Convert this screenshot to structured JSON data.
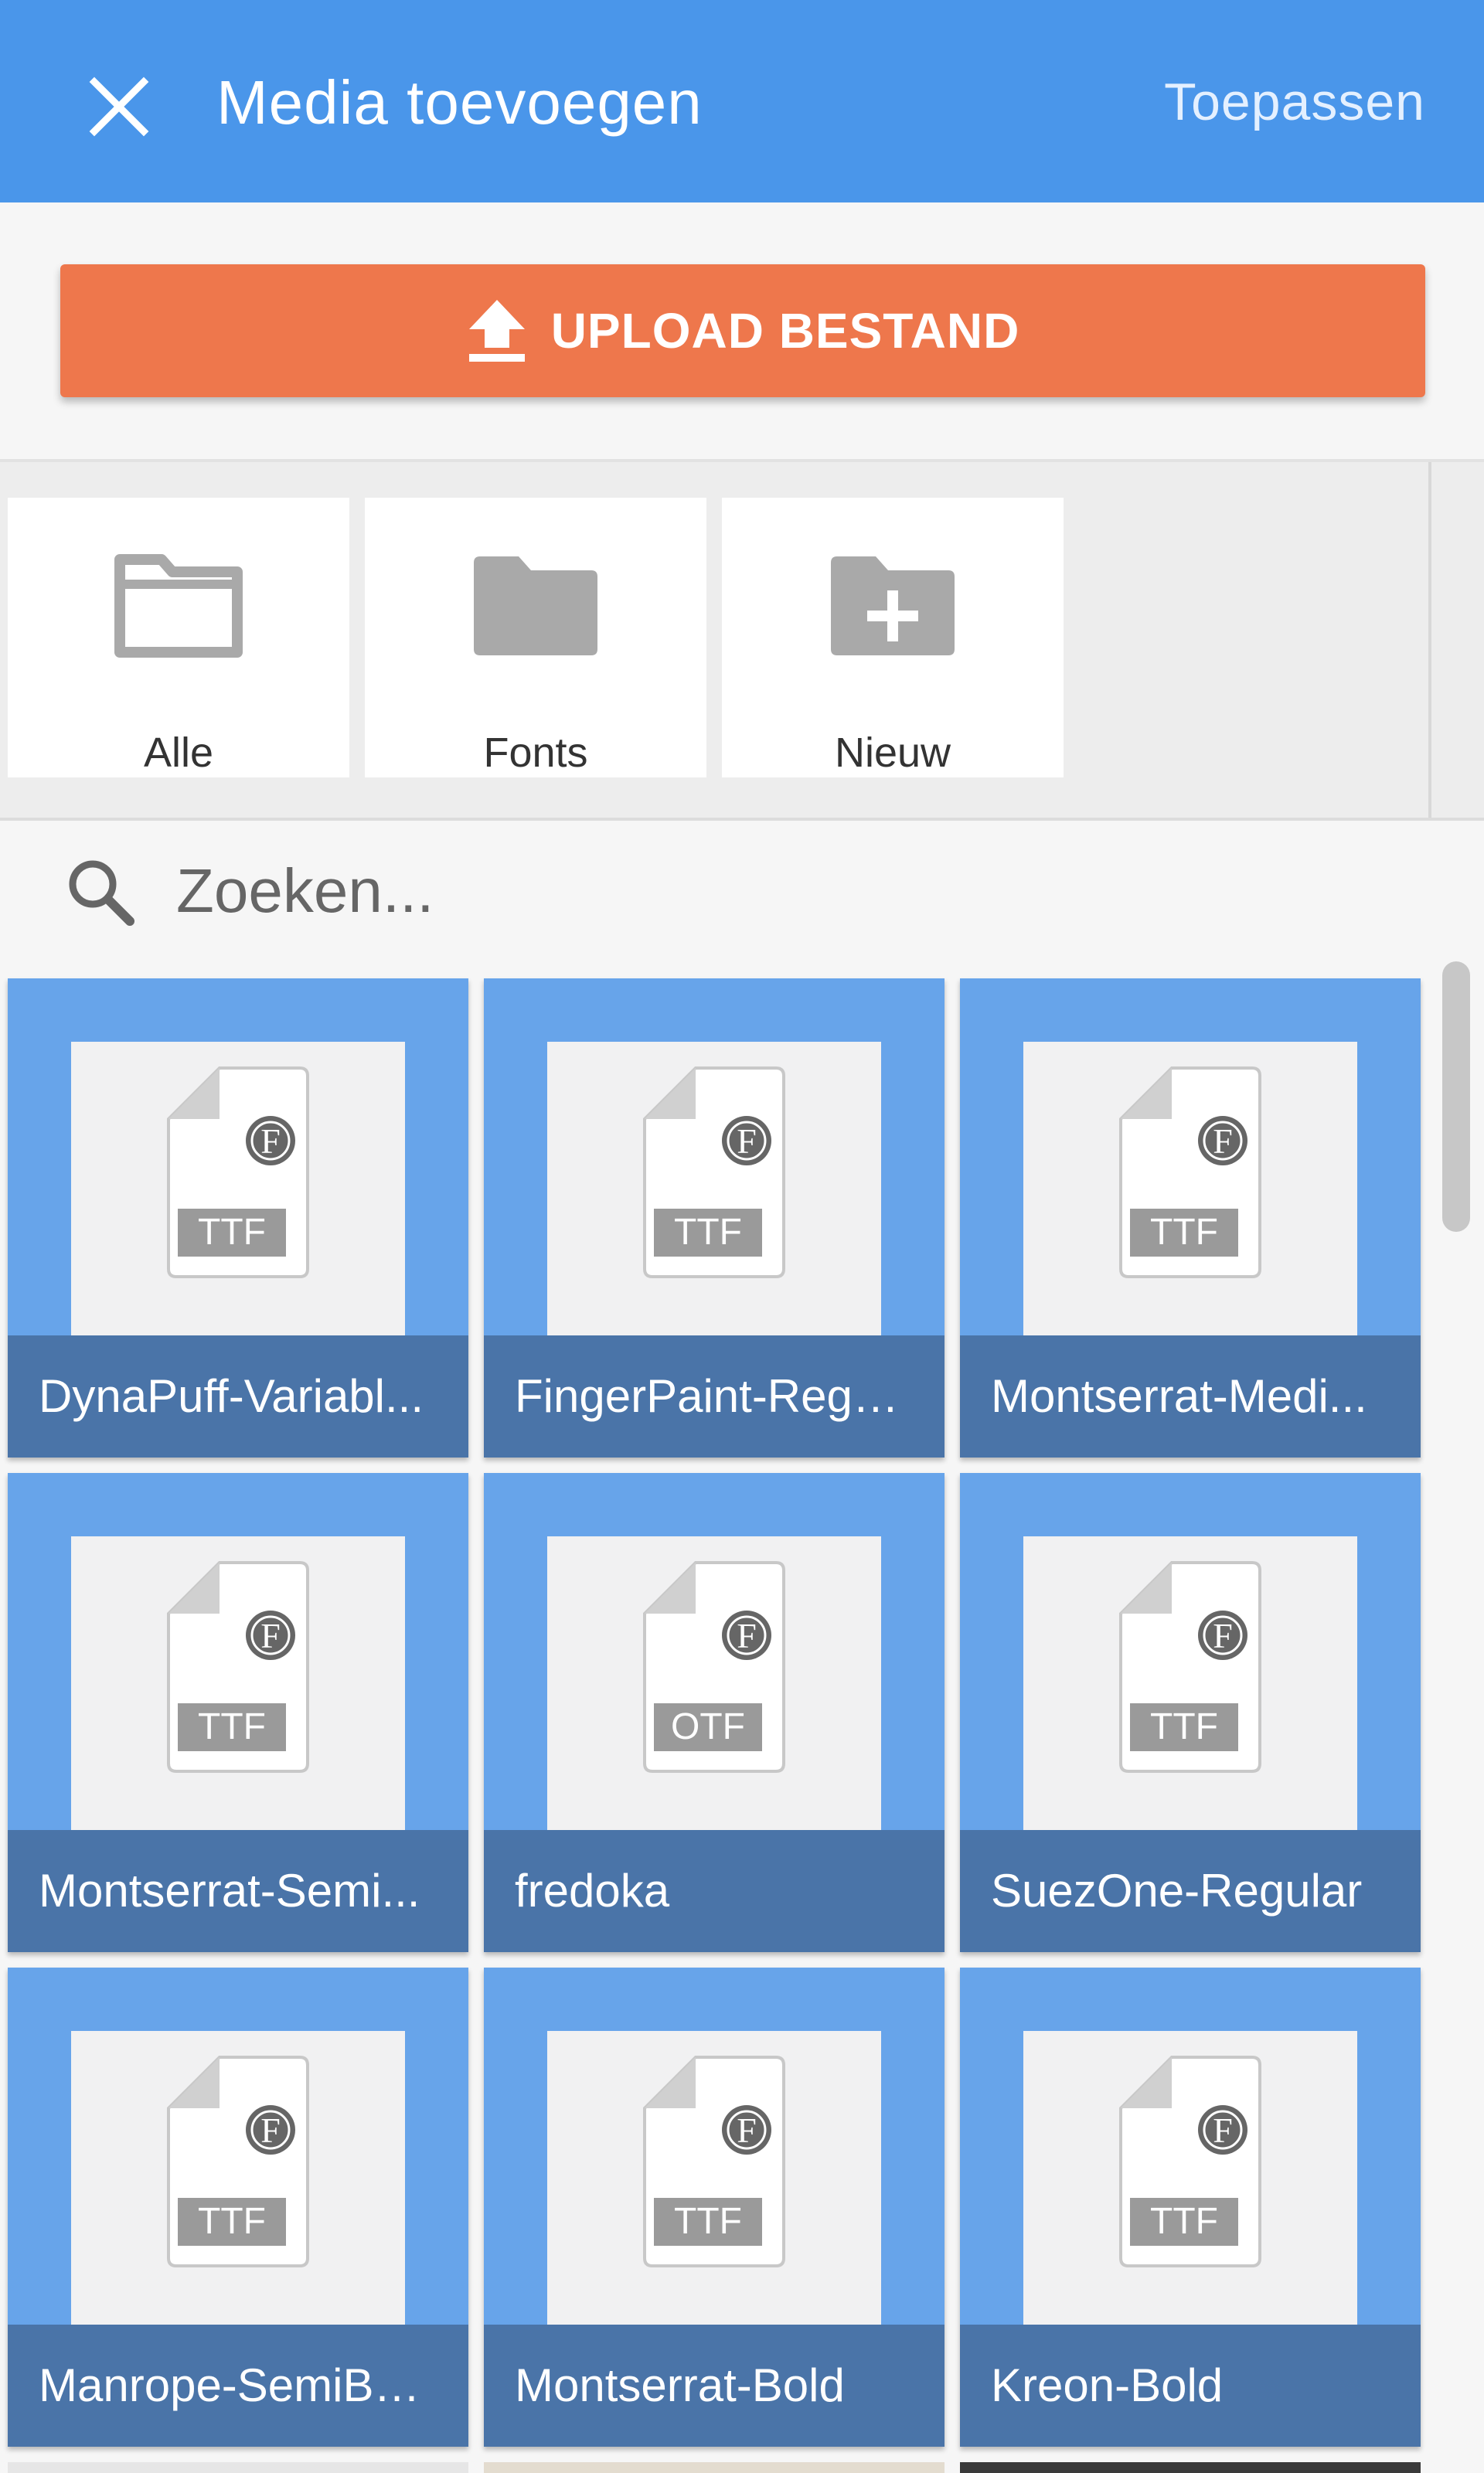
{
  "header": {
    "title": "Media toevoegen",
    "apply_label": "Toepassen",
    "bg_color": "#4a96ea"
  },
  "upload": {
    "label": "UPLOAD BESTAND",
    "icon": "upload-icon",
    "bg_color": "#ee774c"
  },
  "folders": [
    {
      "label": "Alle",
      "icon": "folder-outline-icon"
    },
    {
      "label": "Fonts",
      "icon": "folder-icon"
    },
    {
      "label": "Nieuw",
      "icon": "folder-plus-icon"
    }
  ],
  "search": {
    "placeholder": "Zoeken...",
    "value": ""
  },
  "files": [
    {
      "name": "DynaPuff-Variabl...",
      "type": "TTF"
    },
    {
      "name": "FingerPaint-Regu...",
      "type": "TTF"
    },
    {
      "name": "Montserrat-Medi...",
      "type": "TTF"
    },
    {
      "name": "Montserrat-Semi...",
      "type": "TTF"
    },
    {
      "name": "fredoka",
      "type": "OTF"
    },
    {
      "name": "SuezOne-Regular",
      "type": "TTF"
    },
    {
      "name": "Manrope-SemiBo...",
      "type": "TTF"
    },
    {
      "name": "Montserrat-Bold",
      "type": "TTF"
    },
    {
      "name": "Kreon-Bold",
      "type": "TTF"
    }
  ]
}
